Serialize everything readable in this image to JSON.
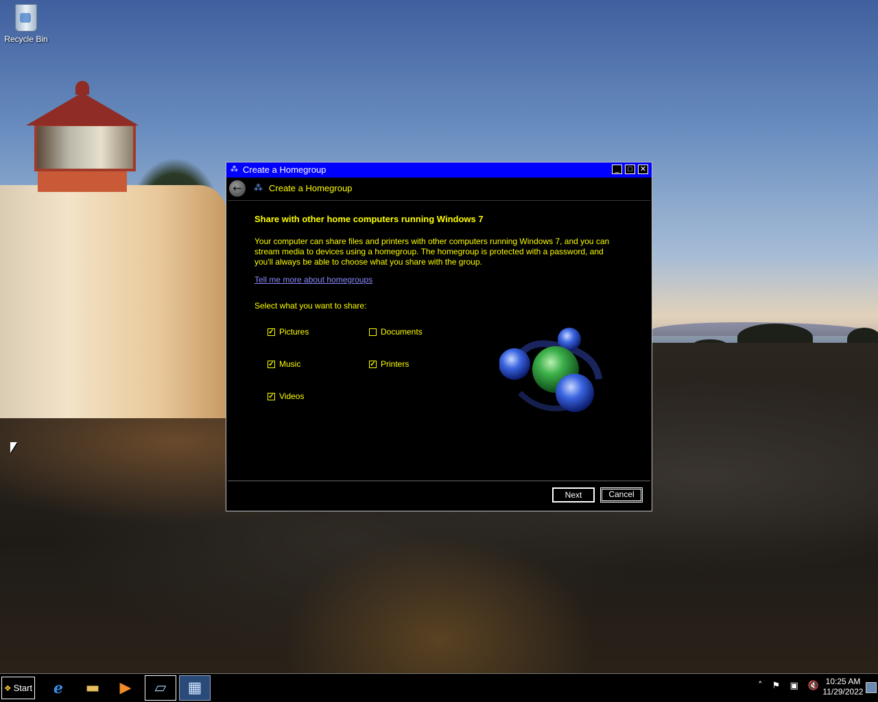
{
  "desktop": {
    "icons": [
      {
        "label": "Recycle Bin",
        "icon": "recycle-bin-icon"
      }
    ]
  },
  "window": {
    "title": "Create a Homegroup",
    "controls": {
      "minimize": "_",
      "maximize": "□",
      "close": "✕"
    },
    "nav_title": "Create a Homegroup",
    "heading": "Share with other home computers running Windows 7",
    "description": "Your computer can share files and printers with other computers running Windows 7, and you can stream media to devices using a homegroup. The homegroup is protected with a password, and you'll always be able to choose what you share with the group.",
    "link": "Tell me more about homegroups",
    "select_label": "Select what you want to share:",
    "share_items": [
      {
        "label": "Pictures",
        "checked": true
      },
      {
        "label": "Music",
        "checked": true
      },
      {
        "label": "Videos",
        "checked": true
      },
      {
        "label": "Documents",
        "checked": false
      },
      {
        "label": "Printers",
        "checked": true
      }
    ],
    "buttons": {
      "next": "Next",
      "cancel": "Cancel"
    }
  },
  "taskbar": {
    "start_label": "Start",
    "pinned": [
      "internet-explorer-icon",
      "file-explorer-icon",
      "media-player-icon",
      "notepad-icon",
      "control-panel-icon"
    ],
    "tray_icons": [
      "show-hidden-icons",
      "action-center-flag-icon",
      "network-icon",
      "volume-muted-icon"
    ],
    "time": "10:25 AM",
    "date": "11/29/2022"
  }
}
